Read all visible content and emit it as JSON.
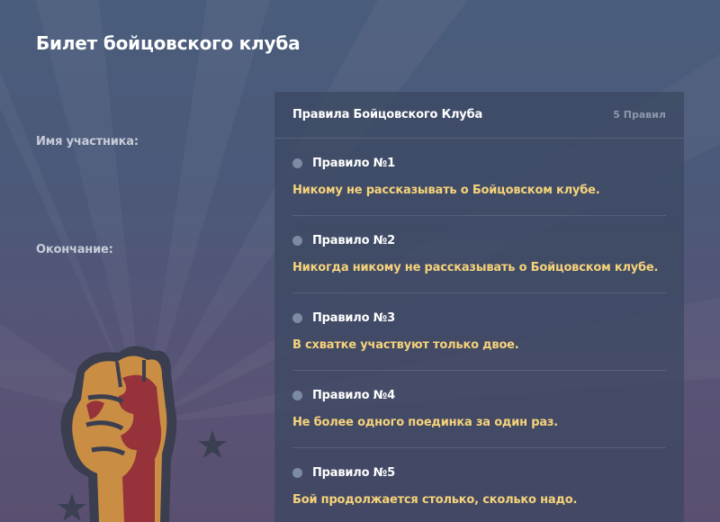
{
  "page": {
    "title": "Билет бойцовского клуба"
  },
  "form": {
    "name_label": "Имя участника:",
    "end_label": "Окончание:"
  },
  "rules": {
    "title": "Правила Бойцовского Клуба",
    "count": "5 Правил",
    "items": [
      {
        "number": "Правило №1",
        "text": "Никому не рассказывать о Бойцовском клубе."
      },
      {
        "number": "Правило №2",
        "text": "Никогда никому не рассказывать о Бойцовском клубе."
      },
      {
        "number": "Правило №3",
        "text": "В схватке участвуют только двое."
      },
      {
        "number": "Правило №4",
        "text": "Не более одного поединка за один раз."
      },
      {
        "number": "Правило №5",
        "text": "Бой продолжается столько, сколько надо."
      }
    ]
  },
  "colors": {
    "accent_text": "#f6d27a",
    "bullet": "#7d8aa3",
    "panel_bg": "#3a4660"
  },
  "icons": {
    "illustration": "raised-fist-icon"
  }
}
